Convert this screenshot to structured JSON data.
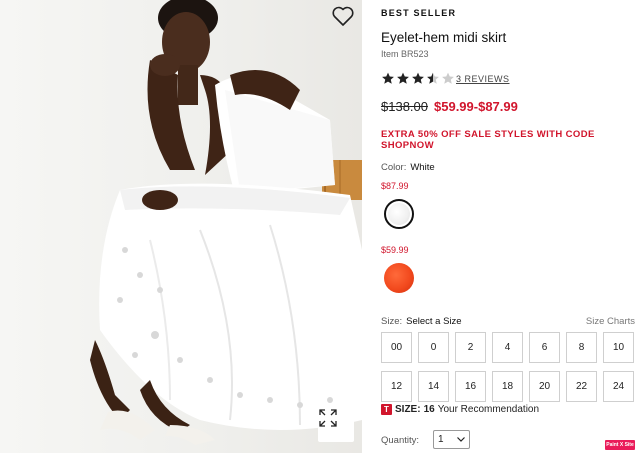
{
  "product": {
    "badge": "BEST SELLER",
    "title": "Eyelet-hem midi skirt",
    "item_number": "Item BR523",
    "rating": 3.5,
    "rating_max": 5,
    "reviews_label": "3 REVIEWS",
    "original_price": "$138.00",
    "sale_price": "$59.99-$87.99",
    "promo": "EXTRA 50% OFF SALE STYLES WITH CODE SHOPNOW"
  },
  "color": {
    "label": "Color:",
    "value": "White",
    "swatches": [
      {
        "price": "$87.99",
        "name": "white",
        "color": "#f2f2f2"
      },
      {
        "price": "$59.99",
        "name": "red-orange",
        "color": "#f24a1e"
      }
    ]
  },
  "size": {
    "label": "Size:",
    "value": "Select a Size",
    "charts_link": "Size Charts",
    "options": [
      "00",
      "0",
      "2",
      "4",
      "6",
      "8",
      "10",
      "12",
      "14",
      "16",
      "18",
      "20",
      "22",
      "24"
    ],
    "recommendation": {
      "prefix": "SIZE:",
      "value": "16",
      "suffix": "Your Recommendation"
    }
  },
  "quantity": {
    "label": "Quantity:",
    "value": "1"
  },
  "pinit_label": "Paint X Site",
  "colors": {
    "accent_red": "#d1152c",
    "text": "#222222",
    "border": "#cfcfcf"
  },
  "icons": {
    "favorite": "heart-outline-icon",
    "zoom": "expand-arrows-icon",
    "recommend": "t-badge-icon"
  }
}
